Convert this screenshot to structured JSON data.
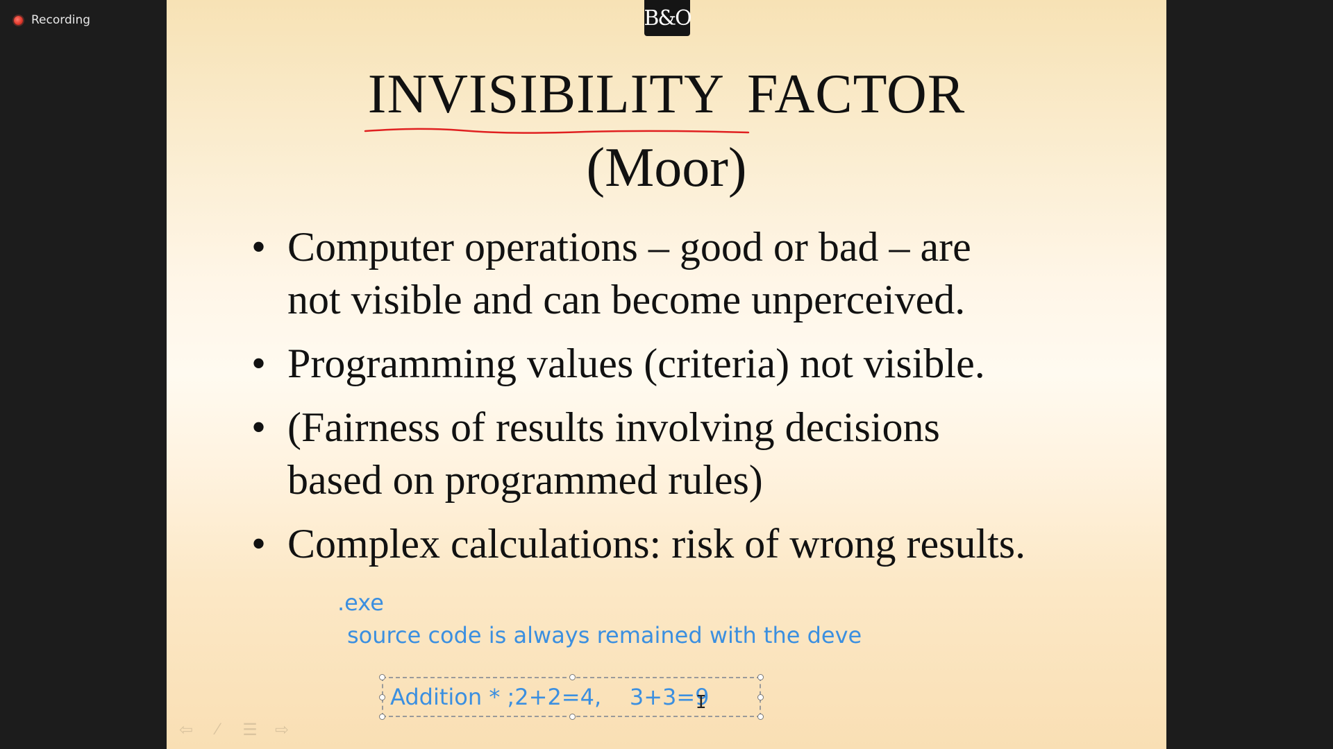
{
  "meeting": {
    "recording_label": "Recording"
  },
  "slide": {
    "logo_text": "B&O",
    "title": "INVISIBILITY FACTOR",
    "subtitle": "(Moor)",
    "bullets": [
      {
        "lines": [
          "Computer operations – good or bad – are",
          "not visible and can become unperceived."
        ]
      },
      {
        "lines": [
          "Programming values (criteria) not visible."
        ]
      },
      {
        "lines": [
          "(Fairness of results involving decisions",
          "based on programmed rules)"
        ]
      },
      {
        "lines": [
          "Complex calculations: risk of wrong results."
        ]
      }
    ],
    "annotations": {
      "exe": ".exe",
      "source": "source code is always remained with the deve",
      "textbox": "Addition * ;2+2=4,    3+3=9"
    },
    "colors": {
      "annotation_text": "#3b8fe0",
      "squiggle": "#e02020"
    },
    "toolbar_icons": [
      "back-arrow-icon",
      "pen-icon",
      "menu-icon",
      "forward-arrow-icon"
    ]
  }
}
